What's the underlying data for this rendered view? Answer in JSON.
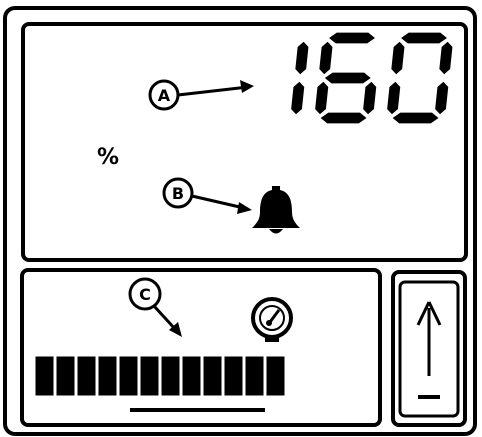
{
  "display": {
    "percent_value": "160",
    "percent_unit": "%",
    "callouts": {
      "a": "A",
      "b": "B",
      "c": "C"
    }
  },
  "bar_graph": {
    "segments_lit": 12,
    "segments_total": 12
  },
  "icons": {
    "alarm": "bell-icon",
    "gauge": "pressure-gauge-icon",
    "direction": "up-arrow-icon"
  },
  "colors": {
    "ink": "#000000",
    "background": "#ffffff"
  }
}
